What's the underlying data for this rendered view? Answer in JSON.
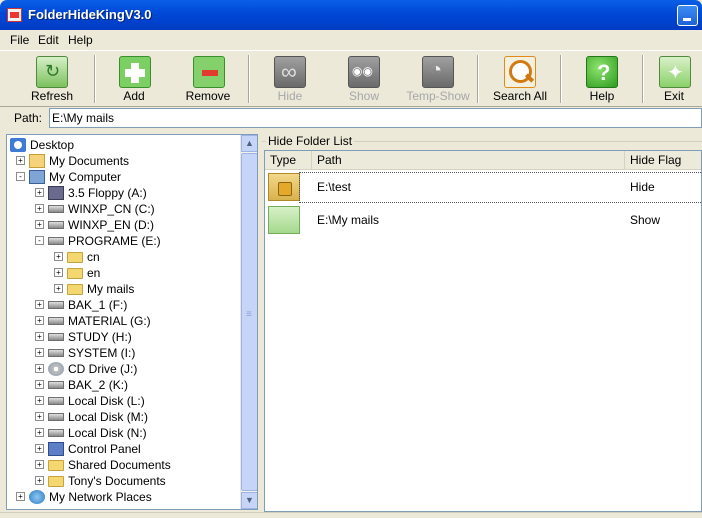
{
  "window": {
    "title": "FolderHideKingV3.0"
  },
  "menu": [
    "File",
    "Edit",
    "Help"
  ],
  "toolbar": {
    "refresh": "Refresh",
    "add": "Add",
    "remove": "Remove",
    "hide": "Hide",
    "show": "Show",
    "temp_show": "Temp-Show",
    "search_all": "Search All",
    "help": "Help",
    "exit": "Exit"
  },
  "path": {
    "label": "Path:",
    "value": "E:\\My mails"
  },
  "tree": [
    {
      "label": "Desktop",
      "icon": "desktop-icon",
      "depth": 0,
      "expander": ""
    },
    {
      "label": "My Documents",
      "icon": "documents-icon",
      "depth": 1,
      "expander": "+"
    },
    {
      "label": "My Computer",
      "icon": "computer-icon",
      "depth": 1,
      "expander": "-"
    },
    {
      "label": "3.5 Floppy (A:)",
      "icon": "floppy-icon",
      "depth": 2,
      "expander": "+"
    },
    {
      "label": "WINXP_CN (C:)",
      "icon": "drive-icon",
      "depth": 2,
      "expander": "+"
    },
    {
      "label": "WINXP_EN (D:)",
      "icon": "drive-icon",
      "depth": 2,
      "expander": "+"
    },
    {
      "label": "PROGRAME (E:)",
      "icon": "drive-icon",
      "depth": 2,
      "expander": "-"
    },
    {
      "label": "cn",
      "icon": "folder-icon",
      "depth": 3,
      "expander": "+"
    },
    {
      "label": "en",
      "icon": "folder-icon",
      "depth": 3,
      "expander": "+"
    },
    {
      "label": "My mails",
      "icon": "folder-icon",
      "depth": 3,
      "expander": "+"
    },
    {
      "label": "BAK_1 (F:)",
      "icon": "drive-icon",
      "depth": 2,
      "expander": "+"
    },
    {
      "label": "MATERIAL (G:)",
      "icon": "drive-icon",
      "depth": 2,
      "expander": "+"
    },
    {
      "label": "STUDY (H:)",
      "icon": "drive-icon",
      "depth": 2,
      "expander": "+"
    },
    {
      "label": "SYSTEM (I:)",
      "icon": "drive-icon",
      "depth": 2,
      "expander": "+"
    },
    {
      "label": "CD Drive (J:)",
      "icon": "cd-icon",
      "depth": 2,
      "expander": "+"
    },
    {
      "label": "BAK_2 (K:)",
      "icon": "drive-icon",
      "depth": 2,
      "expander": "+"
    },
    {
      "label": "Local Disk (L:)",
      "icon": "drive-icon",
      "depth": 2,
      "expander": "+"
    },
    {
      "label": "Local Disk (M:)",
      "icon": "drive-icon",
      "depth": 2,
      "expander": "+"
    },
    {
      "label": "Local Disk (N:)",
      "icon": "drive-icon",
      "depth": 2,
      "expander": "+"
    },
    {
      "label": "Control Panel",
      "icon": "control-panel-icon",
      "depth": 2,
      "expander": "+"
    },
    {
      "label": "Shared Documents",
      "icon": "folder-icon",
      "depth": 2,
      "expander": "+"
    },
    {
      "label": "Tony's Documents",
      "icon": "folder-icon",
      "depth": 2,
      "expander": "+"
    },
    {
      "label": "My Network Places",
      "icon": "network-icon",
      "depth": 1,
      "expander": "+"
    }
  ],
  "folder_list": {
    "caption": "Hide Folder List",
    "columns": [
      "Type",
      "Path",
      "Hide Flag"
    ],
    "rows": [
      {
        "type_icon": "locked-folder-icon",
        "path": "E:\\test",
        "flag": "Hide"
      },
      {
        "type_icon": "folder-icon",
        "path": "E:\\My mails",
        "flag": "Show"
      }
    ]
  }
}
